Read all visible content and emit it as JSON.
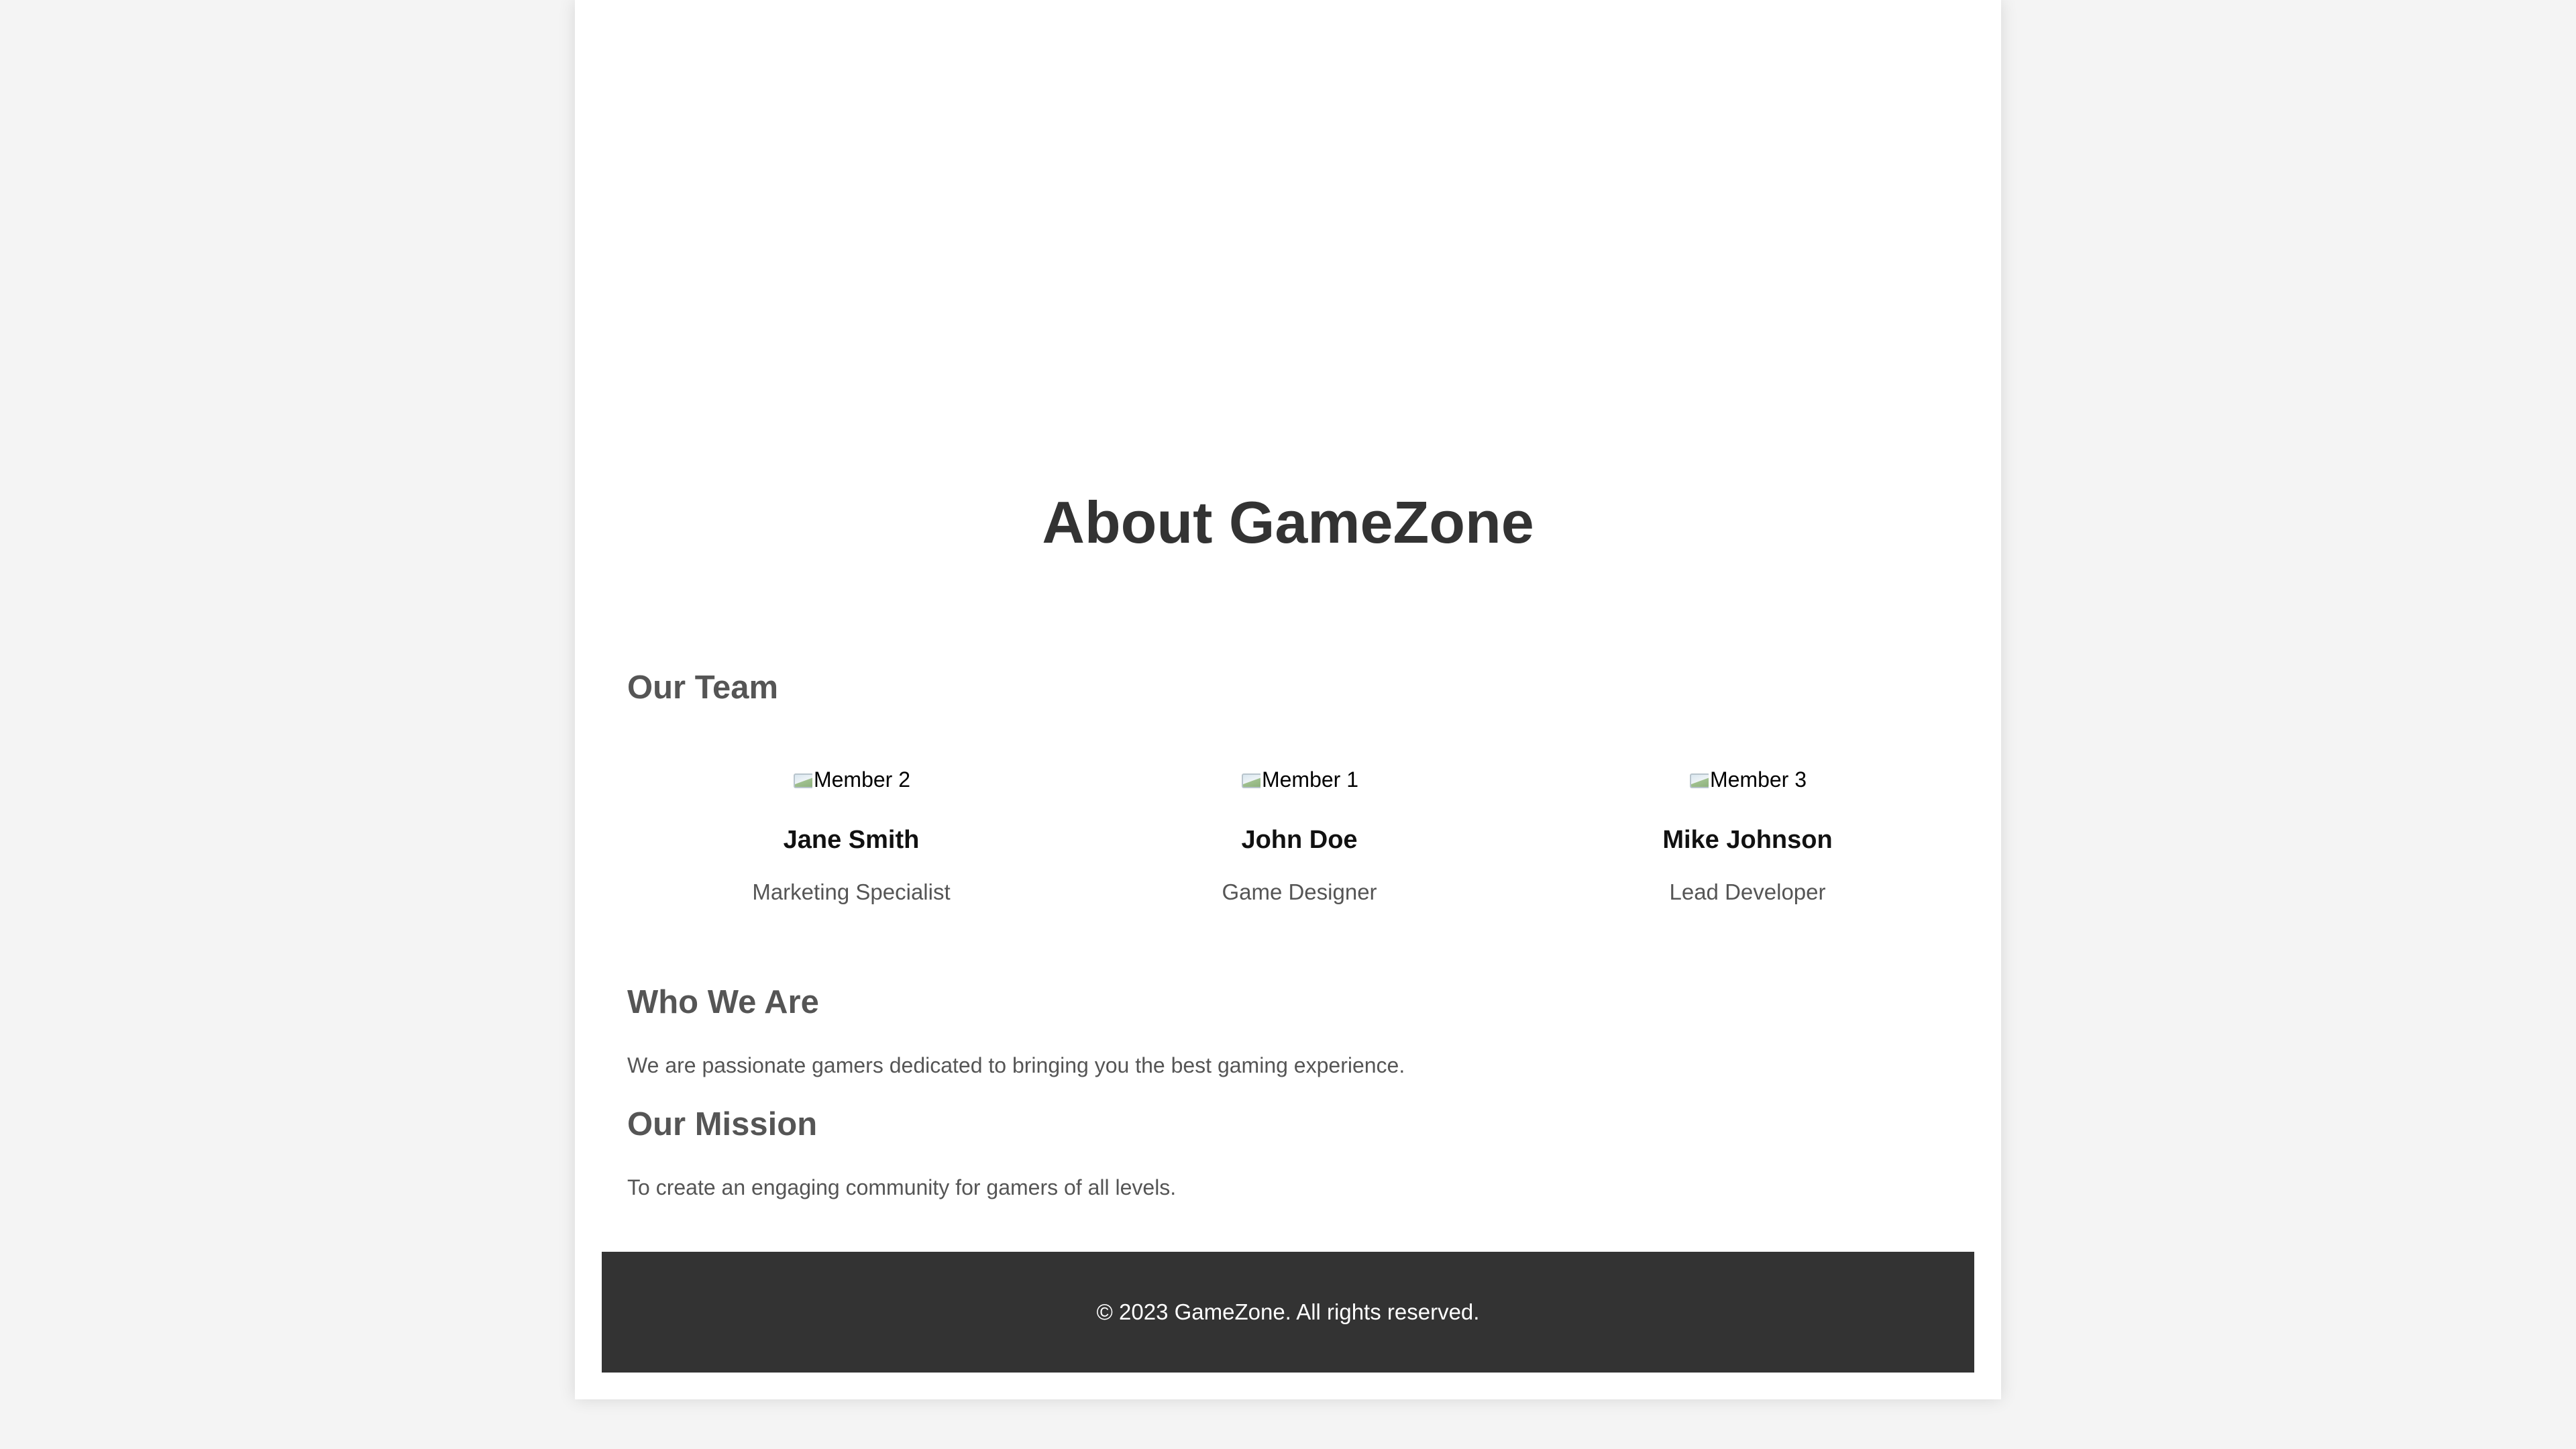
{
  "page": {
    "title": "About GameZone"
  },
  "team": {
    "heading": "Our Team",
    "members": [
      {
        "image_alt": "Member 2",
        "name": "Jane Smith",
        "role": "Marketing Specialist"
      },
      {
        "image_alt": "Member 1",
        "name": "John Doe",
        "role": "Game Designer"
      },
      {
        "image_alt": "Member 3",
        "name": "Mike Johnson",
        "role": "Lead Developer"
      }
    ]
  },
  "who_we_are": {
    "heading": "Who We Are",
    "text": "We are passionate gamers dedicated to bringing you the best gaming experience."
  },
  "mission": {
    "heading": "Our Mission",
    "text": "To create an engaging community for gamers of all levels."
  },
  "footer": {
    "text": "© 2023 GameZone. All rights reserved."
  },
  "colors": {
    "background": "#f4f4f4",
    "card": "#ffffff",
    "heading": "#333333",
    "subheading": "#555555",
    "footer_bg": "#333333",
    "footer_text": "#ffffff"
  }
}
